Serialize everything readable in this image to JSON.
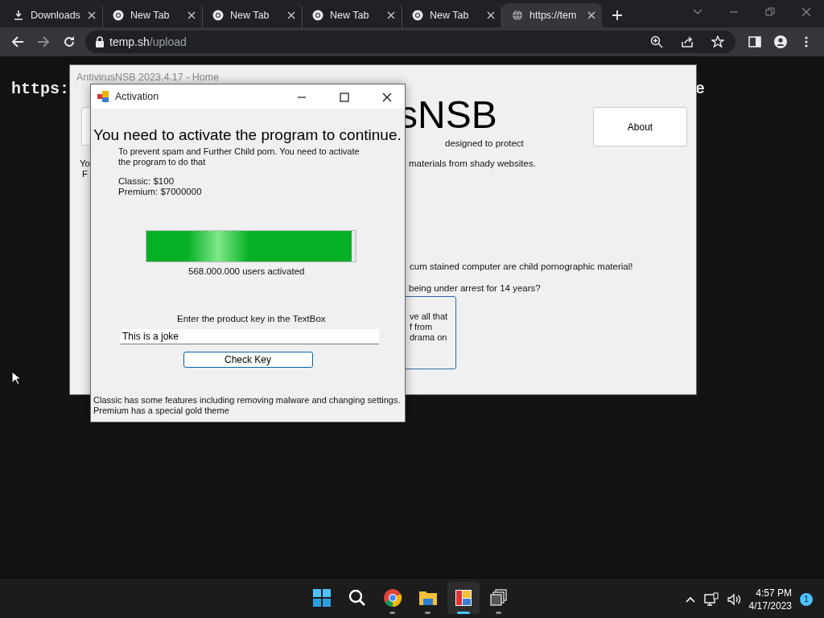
{
  "browser": {
    "tabs": [
      {
        "label": "Downloads",
        "kind": "download",
        "selected": false
      },
      {
        "label": "New Tab",
        "kind": "chrome",
        "selected": false
      },
      {
        "label": "New Tab",
        "kind": "chrome",
        "selected": false
      },
      {
        "label": "New Tab",
        "kind": "chrome",
        "selected": false
      },
      {
        "label": "New Tab",
        "kind": "chrome",
        "selected": false
      },
      {
        "label": "https://tem",
        "kind": "globe",
        "selected": true
      }
    ],
    "url_host": "temp.sh",
    "url_path": "/upload"
  },
  "page_text": [
    "https:",
    "e"
  ],
  "main_window": {
    "title": "AntivirusNSB 2023.4.17 - Home",
    "logo": "sNSB",
    "tagline": "designed to protect",
    "about_button": "About",
    "left_text": [
      "Yo",
      "F"
    ],
    "lines": [
      "materials from shady websites.",
      "cum stained computer are child pornographic material!",
      "being under arrest for 14 years?"
    ],
    "box_lines": [
      "ve all that",
      "f from",
      "drama on"
    ]
  },
  "activation": {
    "title": "Activation",
    "heading": "You need to activate the program to continue.",
    "intro": "To prevent spam and Further Child porn. You need to activate the program to do that",
    "prices": [
      "Classic: $100",
      "Premium: $7000000"
    ],
    "progress": {
      "level": 0.98
    },
    "users": "568.000.000 users activated",
    "key_prompt": "Enter the product key in the TextBox",
    "key_value": "This is a joke",
    "check_button": "Check Key",
    "footer": [
      "Classic has some features including removing malware and changing settings.",
      "Premium has a special gold theme"
    ]
  },
  "taskbar": {
    "apps": [
      {
        "kind": "start",
        "running": false,
        "selected": false
      },
      {
        "kind": "search",
        "running": false,
        "selected": false
      },
      {
        "kind": "chrome",
        "running": true,
        "selected": false
      },
      {
        "kind": "folder",
        "running": true,
        "selected": false
      },
      {
        "kind": "app",
        "running": true,
        "selected": true
      },
      {
        "kind": "taskview",
        "running": true,
        "selected": false
      }
    ],
    "time": "4:57 PM",
    "date": "4/17/2023",
    "notifications": "1"
  }
}
